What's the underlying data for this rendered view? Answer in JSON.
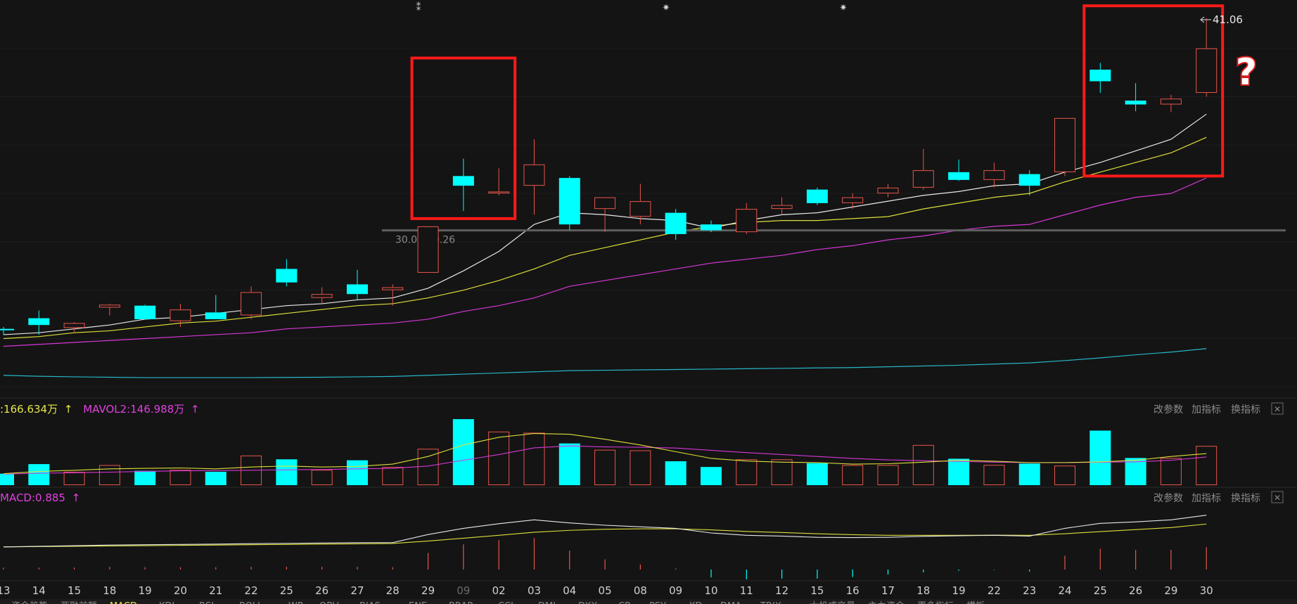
{
  "chart_data": [
    {
      "type": "candlestick",
      "panel": "price",
      "categories": [
        "13",
        "14",
        "15",
        "18",
        "19",
        "20",
        "21",
        "22",
        "25",
        "26",
        "27",
        "28",
        "29",
        "09",
        "02",
        "03",
        "04",
        "05",
        "08",
        "09",
        "10",
        "11",
        "12",
        "15",
        "16",
        "17",
        "18",
        "19",
        "22",
        "23",
        "24",
        "25",
        "26",
        "29",
        "30"
      ],
      "ohlc": [
        [
          25.0,
          25.1,
          24.7,
          24.95
        ],
        [
          25.55,
          25.95,
          24.7,
          25.2
        ],
        [
          25.05,
          25.35,
          24.85,
          25.3
        ],
        [
          26.1,
          26.3,
          25.7,
          26.25
        ],
        [
          26.2,
          26.25,
          25.5,
          25.5
        ],
        [
          25.4,
          26.3,
          25.1,
          26.0
        ],
        [
          25.85,
          26.75,
          25.6,
          25.5
        ],
        [
          25.7,
          27.2,
          25.5,
          26.9
        ],
        [
          28.1,
          28.6,
          27.2,
          27.4
        ],
        [
          26.6,
          27.15,
          26.3,
          26.8
        ],
        [
          27.3,
          28.05,
          26.5,
          26.8
        ],
        [
          27.0,
          27.3,
          26.2,
          27.15
        ],
        [
          27.9,
          30.2,
          27.9,
          30.3
        ],
        [
          32.9,
          33.8,
          31.1,
          32.4
        ],
        [
          32.0,
          33.3,
          31.9,
          32.1
        ],
        [
          32.4,
          34.8,
          30.9,
          33.5
        ],
        [
          32.8,
          32.9,
          30.1,
          30.4
        ],
        [
          31.2,
          31.3,
          30.0,
          31.8
        ],
        [
          30.8,
          32.5,
          30.4,
          31.6
        ],
        [
          31.0,
          31.2,
          29.6,
          29.9
        ],
        [
          30.4,
          30.6,
          30.0,
          30.1
        ],
        [
          30.0,
          31.5,
          29.9,
          31.2
        ],
        [
          31.2,
          31.8,
          30.9,
          31.4
        ],
        [
          32.2,
          32.3,
          31.4,
          31.5
        ],
        [
          31.5,
          32.0,
          31.2,
          31.8
        ],
        [
          32.0,
          32.5,
          31.8,
          32.3
        ],
        [
          32.3,
          34.3,
          32.2,
          33.2
        ],
        [
          33.1,
          33.75,
          32.65,
          32.7
        ],
        [
          32.7,
          33.6,
          32.3,
          33.2
        ],
        [
          33.0,
          33.2,
          31.9,
          32.4
        ],
        [
          33.1,
          35.9,
          32.9,
          35.9
        ],
        [
          38.4,
          38.75,
          37.2,
          37.8
        ],
        [
          36.8,
          37.7,
          36.25,
          36.6
        ],
        [
          36.6,
          37.1,
          36.2,
          36.9
        ],
        [
          37.2,
          41.06,
          37.0,
          39.5
        ]
      ],
      "price_annotations": {
        "high_marker": "41.06",
        "range_label": "30.09-30.26",
        "range_price_low": 30.09
      },
      "ma": {
        "white": [
          24.7,
          24.8,
          25.0,
          25.2,
          25.5,
          25.6,
          25.8,
          26.0,
          26.2,
          26.3,
          26.5,
          26.6,
          27.1,
          28.0,
          29.0,
          30.4,
          31.0,
          30.9,
          30.7,
          30.6,
          30.2,
          30.6,
          30.9,
          31.0,
          31.3,
          31.6,
          31.9,
          32.1,
          32.4,
          32.5,
          33.1,
          33.6,
          34.2,
          34.8,
          36.1
        ],
        "yellow": [
          24.5,
          24.6,
          24.8,
          24.9,
          25.1,
          25.3,
          25.4,
          25.6,
          25.8,
          26.0,
          26.2,
          26.3,
          26.6,
          27.0,
          27.5,
          28.1,
          28.8,
          29.2,
          29.6,
          30.0,
          30.3,
          30.5,
          30.6,
          30.6,
          30.7,
          30.8,
          31.2,
          31.5,
          31.8,
          32.0,
          32.6,
          33.1,
          33.6,
          34.1,
          34.9
        ],
        "magenta": [
          24.1,
          24.2,
          24.3,
          24.4,
          24.5,
          24.6,
          24.7,
          24.8,
          25.0,
          25.1,
          25.2,
          25.3,
          25.5,
          25.9,
          26.2,
          26.6,
          27.2,
          27.5,
          27.8,
          28.1,
          28.4,
          28.6,
          28.8,
          29.1,
          29.3,
          29.6,
          29.8,
          30.1,
          30.3,
          30.4,
          30.9,
          31.4,
          31.8,
          32.0,
          32.8
        ],
        "cyan": [
          22.6,
          22.55,
          22.52,
          22.5,
          22.48,
          22.48,
          22.48,
          22.48,
          22.49,
          22.5,
          22.52,
          22.54,
          22.6,
          22.66,
          22.72,
          22.78,
          22.84,
          22.86,
          22.88,
          22.9,
          22.92,
          22.94,
          22.96,
          22.98,
          23.0,
          23.04,
          23.08,
          23.12,
          23.18,
          23.24,
          23.36,
          23.5,
          23.66,
          23.8,
          23.98
        ]
      },
      "ylim": [
        21.5,
        42.0
      ],
      "highlight_boxes": [
        {
          "from_index": 12,
          "to_index": 15,
          "y_top": 39.0,
          "y_bottom": 30.7
        },
        {
          "from_index": 31,
          "to_index": 35,
          "y_top": 41.7,
          "y_bottom": 32.9
        }
      ],
      "question_mark": "?",
      "top_markers": [
        "⁑",
        "✷",
        "✷"
      ]
    },
    {
      "type": "bar",
      "panel": "volume",
      "legend": [
        {
          "label": ":166.634万",
          "arrow": "↑",
          "color": "#e6e64a"
        },
        {
          "label": "MAVOL2:146.988万",
          "arrow": "↑",
          "color": "#e040e0"
        }
      ],
      "buttons": [
        "改参数",
        "加指标",
        "换指标"
      ],
      "close_glyph": "✕",
      "unit": "万",
      "values": [
        60,
        110,
        70,
        105,
        75,
        80,
        70,
        155,
        135,
        80,
        130,
        95,
        190,
        345,
        280,
        274,
        218,
        185,
        182,
        125,
        95,
        135,
        135,
        115,
        105,
        105,
        210,
        138,
        106,
        113,
        102,
        285,
        142,
        142,
        205
      ],
      "mavol1": [
        60,
        72,
        78,
        85,
        88,
        90,
        85,
        95,
        100,
        95,
        98,
        110,
        150,
        210,
        250,
        270,
        266,
        240,
        210,
        175,
        140,
        126,
        120,
        118,
        110,
        112,
        120,
        130,
        125,
        118,
        118,
        122,
        130,
        150,
        165
      ],
      "mavol2": [
        58,
        62,
        65,
        68,
        72,
        75,
        76,
        78,
        80,
        82,
        85,
        88,
        100,
        130,
        160,
        195,
        205,
        200,
        198,
        194,
        182,
        170,
        160,
        150,
        140,
        132,
        128,
        124,
        120,
        118,
        118,
        120,
        122,
        130,
        147
      ]
    },
    {
      "type": "macd",
      "panel": "macd",
      "legend": [
        {
          "label": "MACD:0.885",
          "arrow": "↑",
          "color": "#e040e0"
        }
      ],
      "buttons": [
        "改参数",
        "加指标",
        "换指标"
      ],
      "close_glyph": "✕",
      "dif": [
        0.1,
        0.14,
        0.18,
        0.22,
        0.24,
        0.26,
        0.28,
        0.31,
        0.33,
        0.35,
        0.37,
        0.38,
        0.9,
        1.3,
        1.6,
        1.85,
        1.65,
        1.5,
        1.4,
        1.3,
        1.0,
        0.85,
        0.8,
        0.72,
        0.7,
        0.72,
        0.78,
        0.82,
        0.85,
        0.8,
        1.3,
        1.62,
        1.72,
        1.85,
        2.15
      ],
      "dea": [
        0.1,
        0.12,
        0.14,
        0.16,
        0.18,
        0.2,
        0.22,
        0.24,
        0.26,
        0.28,
        0.3,
        0.32,
        0.48,
        0.66,
        0.85,
        1.05,
        1.17,
        1.24,
        1.27,
        1.27,
        1.2,
        1.1,
        1.03,
        0.95,
        0.89,
        0.85,
        0.85,
        0.85,
        0.86,
        0.85,
        0.95,
        1.09,
        1.22,
        1.35,
        1.58
      ],
      "hist": [
        0.1,
        0.1,
        0.1,
        0.14,
        0.12,
        0.12,
        0.12,
        0.14,
        0.14,
        0.14,
        0.14,
        0.12,
        0.84,
        1.28,
        1.5,
        1.6,
        0.96,
        0.52,
        0.26,
        0.06,
        -0.4,
        -0.5,
        -0.46,
        -0.46,
        -0.38,
        -0.26,
        -0.14,
        -0.06,
        -0.02,
        -0.1,
        0.7,
        1.06,
        1.0,
        1.0,
        1.14
      ],
      "dim_zero_index": 22
    }
  ],
  "x_axis_labels": [
    "13",
    "14",
    "15",
    "18",
    "19",
    "20",
    "21",
    "22",
    "25",
    "26",
    "27",
    "28",
    "29",
    "09",
    "02",
    "03",
    "04",
    "05",
    "08",
    "09",
    "10",
    "11",
    "12",
    "15",
    "16",
    "17",
    "18",
    "19",
    "22",
    "23",
    "24",
    "25",
    "26",
    "29",
    "30"
  ],
  "x_axis_dim_index": 13,
  "bottom_tabs": [
    "资金趋势",
    "两融前额",
    "MACD",
    "KDJ",
    "RSI",
    "BOLL",
    "WR",
    "OBV",
    "BIAS",
    "ENE",
    "BRAR",
    "CCI",
    "DMI",
    "DKX",
    "CR",
    "PSY",
    "KD",
    "DMA",
    "TRIX",
    "大机成交量",
    "主力资金",
    "更多指标",
    "横板"
  ],
  "active_tab": "MACD",
  "colors": {
    "background": "#141414",
    "up": "#e8554a",
    "down": "#00ffff",
    "ma_white": "#e8e8e8",
    "ma_yellow": "#dede3a",
    "ma_magenta": "#d637d6",
    "ma_cyan": "#27b6c9",
    "box": "#ff1a1a",
    "gray_text": "#8a8a8a"
  }
}
